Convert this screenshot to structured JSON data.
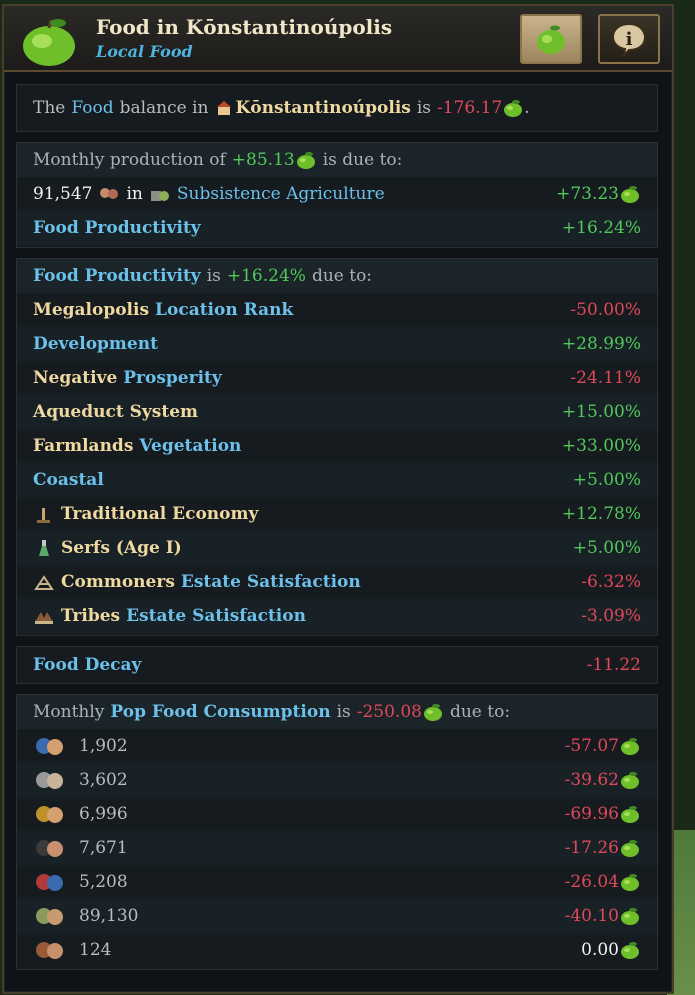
{
  "header": {
    "title": "Food in Kōnstantinoúpolis",
    "subtitle": "Local Food"
  },
  "balance": {
    "prefix": "The",
    "resource": "Food",
    "mid": "balance in",
    "location": "Kōnstantinoúpolis",
    "is": "is",
    "value": "-176.17",
    "suffix": "."
  },
  "production": {
    "head_prefix": "Monthly production of",
    "head_value": "+85.13",
    "head_suffix": "is due to:",
    "subsistence": {
      "pops": "91,547",
      "in": "in",
      "label": "Subsistence Agriculture",
      "value": "+73.23"
    },
    "productivity": {
      "label": "Food Productivity",
      "value": "+16.24%"
    }
  },
  "productivity": {
    "head_label": "Food Productivity",
    "head_is": "is",
    "head_value": "+16.24%",
    "head_suffix": "due to:",
    "rows": [
      {
        "a": "Megalopolis",
        "b": "Location Rank",
        "value": "-50.00%"
      },
      {
        "a": "",
        "b": "Development",
        "value": "+28.99%"
      },
      {
        "a": "Negative",
        "b": "Prosperity",
        "value": "-24.11%"
      },
      {
        "a": "Aqueduct System",
        "b": "",
        "value": "+15.00%"
      },
      {
        "a": "Farmlands",
        "b": "Vegetation",
        "value": "+33.00%"
      },
      {
        "a": "",
        "b": "Coastal",
        "value": "+5.00%"
      },
      {
        "a": "Traditional Economy",
        "b": "",
        "value": "+12.78%"
      },
      {
        "a": "Serfs (Age I)",
        "b": "",
        "value": "+5.00%"
      },
      {
        "a": "Commoners",
        "b": "Estate Satisfaction",
        "value": "-6.32%"
      },
      {
        "a": "Tribes",
        "b": "Estate Satisfaction",
        "value": "-3.09%"
      }
    ]
  },
  "decay": {
    "label": "Food Decay",
    "value": "-11.22"
  },
  "consumption": {
    "head_prefix": "Monthly",
    "head_label": "Pop Food Consumption",
    "head_is": "is",
    "head_value": "-250.08",
    "head_suffix": "due to:",
    "rows": [
      {
        "count": "1,902",
        "value": "-57.07"
      },
      {
        "count": "3,602",
        "value": "-39.62"
      },
      {
        "count": "6,996",
        "value": "-69.96"
      },
      {
        "count": "7,671",
        "value": "-17.26"
      },
      {
        "count": "5,208",
        "value": "-26.04"
      },
      {
        "count": "89,130",
        "value": "-40.10"
      },
      {
        "count": "124",
        "value": "0.00"
      }
    ]
  },
  "colors": {
    "positive": "#52c85a",
    "negative": "#e0485a",
    "link": "#6cc0ea",
    "gold": "#f0d9a0"
  }
}
